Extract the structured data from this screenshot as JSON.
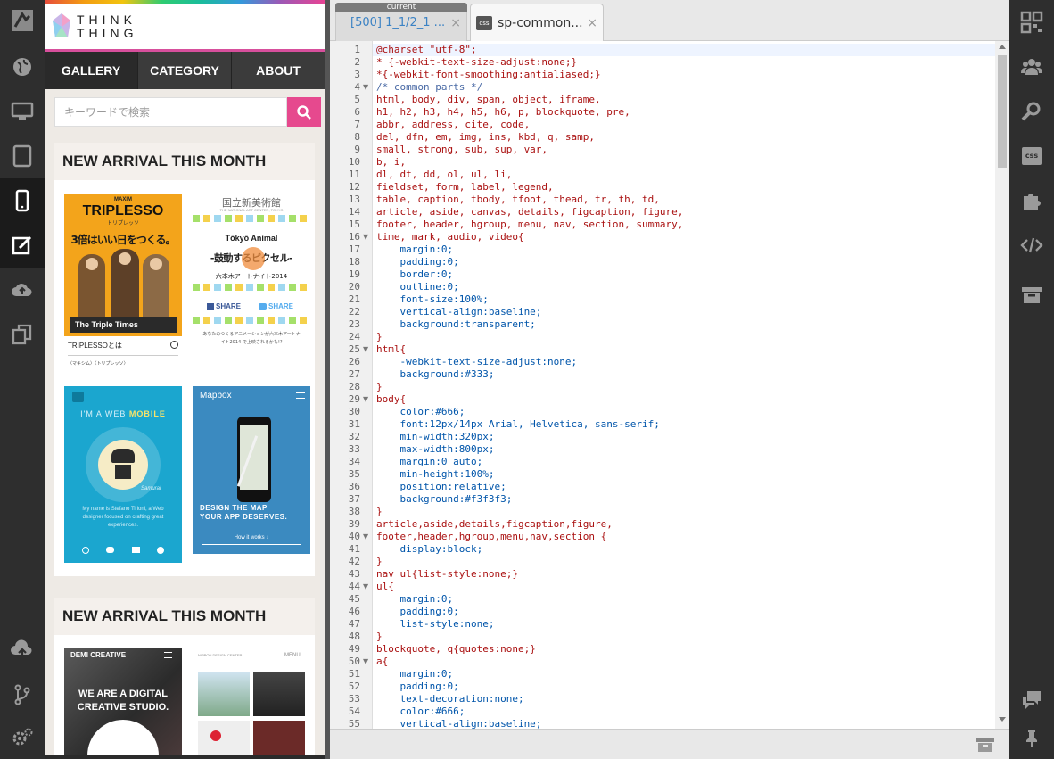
{
  "left_rail": {
    "items": [
      "logo-icon",
      "globe-icon",
      "desktop-icon",
      "tablet-icon",
      "smartphone-icon",
      "edit-icon",
      "cloud-upload-icon",
      "copy-icon",
      "cloud-up-icon",
      "git-branch-icon",
      "settings-icon"
    ]
  },
  "site": {
    "logo_line1": "THINK",
    "logo_line2": "THING",
    "nav": [
      "GALLERY",
      "CATEGORY",
      "ABOUT"
    ],
    "search_placeholder": "キーワードで検索",
    "section_title_1": "NEW ARRIVAL THIS MONTH",
    "section_title_2": "NEW ARRIVAL THIS MONTH",
    "thumbs": {
      "triplesso_brand": "MAXIM",
      "triplesso_title": "TRIPLESSO",
      "triplesso_sub": "トリプレッソ",
      "triplesso_copy": "3倍はいい日をつくる。",
      "triplesso_times": "The Triple Times",
      "triplesso_link": "TRIPLESSOとは",
      "triplesso_foot": "〈マキシム〉〈トリプレッソ〉",
      "nact_title": "国立新美術館",
      "nact_sub": "THE NATIONAL ART CENTER, TOKYO",
      "nact_event": "Tōkyō Animal",
      "nact_pixel": "-鼓動するピクセル-",
      "nact_night": "六本木アートナイト2014",
      "nact_share_fb": "SHARE",
      "nact_share_tw": "SHARE",
      "nact_foot": "あなたのつくるアニメーションが六本木アートナイト2014 で上映されるかも!?",
      "web_mobile_1": "I'M A WEB",
      "web_mobile_2": "MOBILE",
      "web_mobile_sig": "Samurai",
      "web_mobile_desc": "My name is Stefano Tirloni, a Web designer focused on crafting great experiences.",
      "mapbox_name": "Mapbox",
      "mapbox_line1": "DESIGN THE MAP",
      "mapbox_line2": "YOUR APP DESERVES.",
      "mapbox_btn": "How it works ↓",
      "demi_name": "DEMI CREATIVE",
      "demi_line1": "WE ARE A DIGITAL",
      "demi_line2": "CREATIVE STUDIO.",
      "nippon_name": "NIPPON DESIGN CENTER",
      "nippon_menu": "MENU"
    }
  },
  "editor": {
    "current_label": "current",
    "tab1_label": "[500] 1_1/2_1 ...",
    "tab2_label": "sp-common...",
    "tab_close": "×",
    "css_badge": "css",
    "lines": [
      "@charset \"utf-8\";",
      "* {-webkit-text-size-adjust:none;}",
      "*{-webkit-font-smoothing:antialiased;}",
      "/* common parts */",
      "html, body, div, span, object, iframe,",
      "h1, h2, h3, h4, h5, h6, p, blockquote, pre,",
      "abbr, address, cite, code,",
      "del, dfn, em, img, ins, kbd, q, samp,",
      "small, strong, sub, sup, var,",
      "b, i,",
      "dl, dt, dd, ol, ul, li,",
      "fieldset, form, label, legend,",
      "table, caption, tbody, tfoot, thead, tr, th, td,",
      "article, aside, canvas, details, figcaption, figure,",
      "footer, header, hgroup, menu, nav, section, summary,",
      "time, mark, audio, video{",
      "    margin:0;",
      "    padding:0;",
      "    border:0;",
      "    outline:0;",
      "    font-size:100%;",
      "    vertical-align:baseline;",
      "    background:transparent;",
      "}",
      "html{",
      "    -webkit-text-size-adjust:none;",
      "    background:#333;",
      "}",
      "body{",
      "    color:#666;",
      "    font:12px/14px Arial, Helvetica, sans-serif;",
      "    min-width:320px;",
      "    max-width:800px;",
      "    margin:0 auto;",
      "    min-height:100%;",
      "    position:relative;",
      "    background:#f3f3f3;",
      "}",
      "article,aside,details,figcaption,figure,",
      "footer,header,hgroup,menu,nav,section {",
      "    display:block;",
      "}",
      "nav ul{list-style:none;}",
      "ul{",
      "    margin:0;",
      "    padding:0;",
      "    list-style:none;",
      "}",
      "blockquote, q{quotes:none;}",
      "a{",
      "    margin:0;",
      "    padding:0;",
      "    text-decoration:none;",
      "    color:#666;",
      "    vertical-align:baseline;"
    ],
    "line_numbers": [
      "1",
      "2",
      "3",
      "4",
      "5",
      "6",
      "7",
      "8",
      "9",
      "10",
      "11",
      "12",
      "13",
      "14",
      "15",
      "16",
      "17",
      "18",
      "19",
      "20",
      "21",
      "22",
      "23",
      "24",
      "25",
      "26",
      "27",
      "28",
      "29",
      "30",
      "31",
      "32",
      "33",
      "34",
      "35",
      "36",
      "37",
      "38",
      "39",
      "40",
      "41",
      "42",
      "43",
      "44",
      "45",
      "46",
      "47",
      "48",
      "49",
      "50",
      "51",
      "52",
      "53",
      "54",
      "55"
    ]
  },
  "right_rail": {
    "items": [
      "qr-code-icon",
      "users-icon",
      "search-icon",
      "css-icon",
      "puzzle-icon",
      "code-icon",
      "archive-icon",
      "chat-icon",
      "pin-icon"
    ]
  },
  "colors": {
    "accent": "#e6498e",
    "nav_bg": "#3b3b3b",
    "rail_bg": "#2e2e2e"
  }
}
